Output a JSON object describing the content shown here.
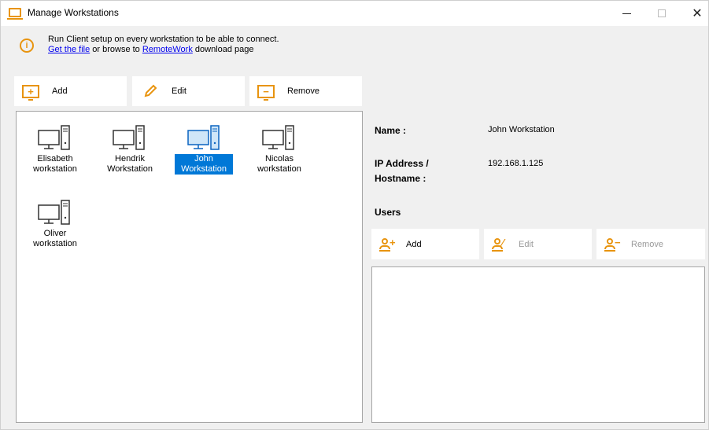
{
  "window": {
    "title": "Manage Workstations",
    "controls": {
      "minimize": "—",
      "maximize": "☐",
      "close": "✕"
    }
  },
  "info": {
    "line1": "Run Client setup on every workstation to be able to connect.",
    "link_get_file": "Get the file",
    "middle_text": " or browse to ",
    "link_remotework": "RemoteWork",
    "tail_text": " download page",
    "icon": "info-icon"
  },
  "toolbar": {
    "add_label": "Add",
    "edit_label": "Edit",
    "remove_label": "Remove"
  },
  "workstations": [
    {
      "line1": "Elisabeth",
      "line2": "workstation",
      "selected": false
    },
    {
      "line1": "Hendrik",
      "line2": "Workstation",
      "selected": false
    },
    {
      "line1": "John",
      "line2": "Workstation",
      "selected": true
    },
    {
      "line1": "Nicolas",
      "line2": "workstation",
      "selected": false
    },
    {
      "line1": "Oliver",
      "line2": "workstation",
      "selected": false
    }
  ],
  "details": {
    "name_label": "Name :",
    "name_value": "John Workstation",
    "ip_label_line1": "IP Address /",
    "ip_label_line2": "Hostname :",
    "ip_value": "192.168.1.125",
    "users_label": "Users"
  },
  "user_toolbar": {
    "add_label": "Add",
    "edit_label": "Edit",
    "remove_label": "Remove",
    "edit_enabled": false,
    "remove_enabled": false
  },
  "colors": {
    "accent": "#e8940f",
    "selection": "#0078d7",
    "link": "#0000ee"
  }
}
